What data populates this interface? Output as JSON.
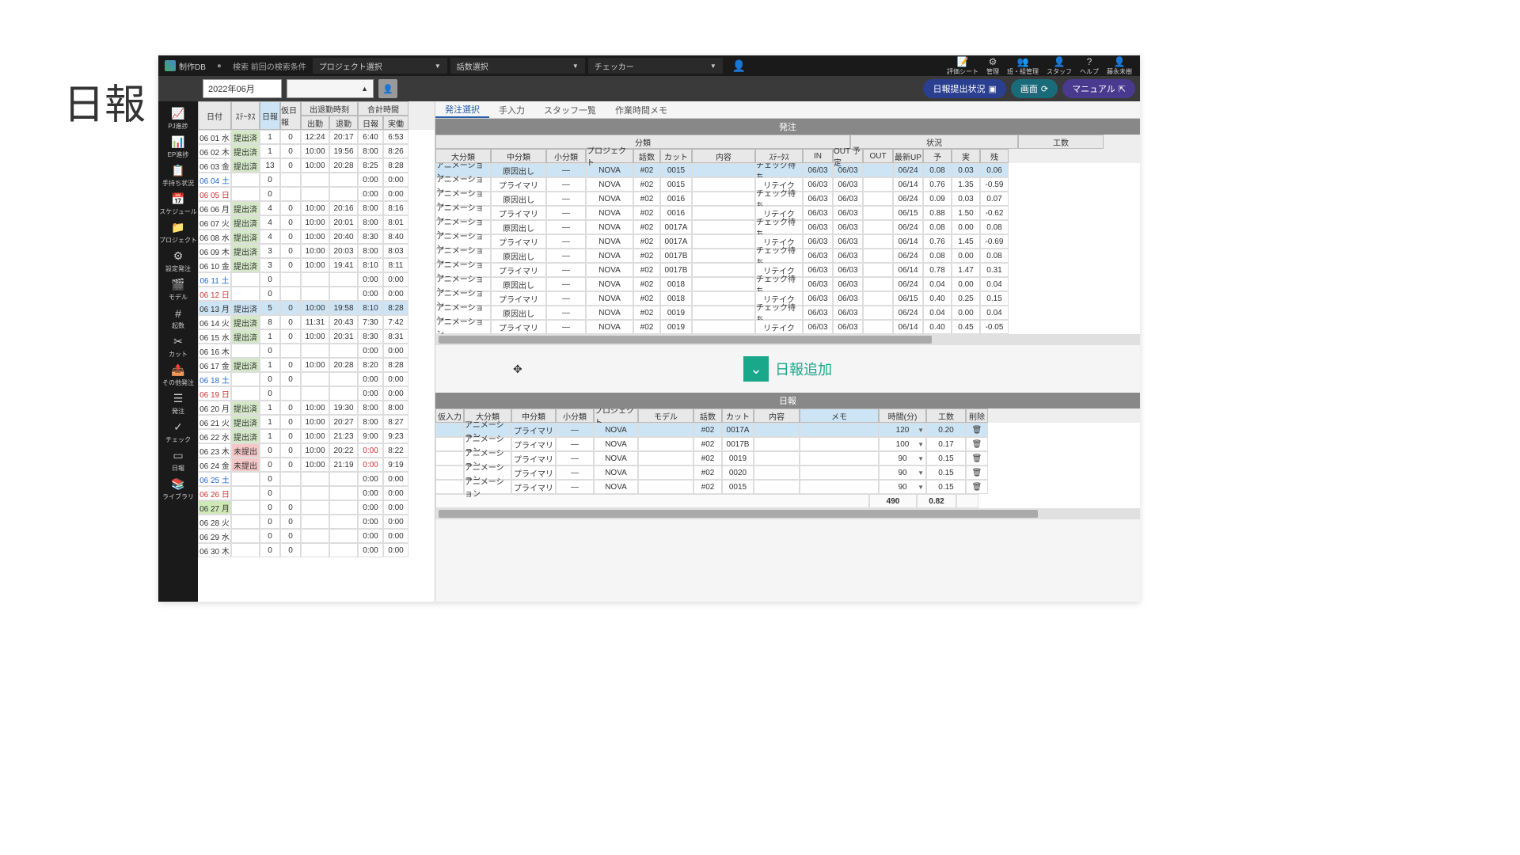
{
  "page_title": "日報",
  "topbar": {
    "app_name": "制作DB",
    "search_label": "検索 前回の検索条件",
    "dropdowns": [
      "プロジェクト選択",
      "話数選択",
      "チェッカー"
    ],
    "right_buttons": [
      {
        "icon": "📝",
        "label": "評価シート"
      },
      {
        "icon": "⚙",
        "label": "管理"
      },
      {
        "icon": "👥",
        "label": "班・組管理"
      },
      {
        "icon": "👤",
        "label": "スタッフ"
      },
      {
        "icon": "?",
        "label": "ヘルプ"
      },
      {
        "icon": "👤",
        "label": "藤永未樹"
      }
    ]
  },
  "filterbar": {
    "month": "2022年06月",
    "pills": [
      {
        "label": "日報提出状況",
        "icon": "▣"
      },
      {
        "label": "画面",
        "icon": "⟳"
      },
      {
        "label": "マニュアル",
        "icon": "⇱"
      }
    ]
  },
  "sidenav": [
    {
      "icon": "📈",
      "label": "PJ進捗"
    },
    {
      "icon": "📊",
      "label": "EP進捗"
    },
    {
      "icon": "📋",
      "label": "手持ち状況"
    },
    {
      "icon": "📅",
      "label": "スケジュール"
    },
    {
      "icon": "📁",
      "label": "プロジェクト"
    },
    {
      "icon": "⚙",
      "label": "設定発注"
    },
    {
      "icon": "🎬",
      "label": "モデル"
    },
    {
      "icon": "#",
      "label": "起数"
    },
    {
      "icon": "✂",
      "label": "カット"
    },
    {
      "icon": "📤",
      "label": "その他発注"
    },
    {
      "icon": "☰",
      "label": "発注"
    },
    {
      "icon": "✓",
      "label": "チェック"
    },
    {
      "icon": "▭",
      "label": "日報"
    },
    {
      "icon": "📚",
      "label": "ライブラリ"
    }
  ],
  "left_table": {
    "head_top": [
      "日付",
      "ｽﾃｰﾀｽ",
      "日報",
      "仮日報",
      "出退勤時刻",
      "合計時間"
    ],
    "head_bot": [
      "出勤",
      "退勤",
      "日報",
      "実働"
    ],
    "rows": [
      {
        "d": "06 01 水",
        "st": "提出済",
        "n": "1",
        "k": "0",
        "in": "12:24",
        "out": "20:17",
        "hn": "6:40",
        "jw": "6:53"
      },
      {
        "d": "06 02 木",
        "st": "提出済",
        "n": "1",
        "k": "0",
        "in": "10:00",
        "out": "19:56",
        "hn": "8:00",
        "jw": "8:26"
      },
      {
        "d": "06 03 金",
        "st": "提出済",
        "n": "13",
        "k": "0",
        "in": "10:00",
        "out": "20:28",
        "hn": "8:25",
        "jw": "8:28"
      },
      {
        "d": "06 04 土",
        "cls": "sat",
        "st": "",
        "n": "0",
        "k": "",
        "in": "",
        "out": "",
        "hn": "0:00",
        "jw": "0:00"
      },
      {
        "d": "06 05 日",
        "cls": "sun",
        "st": "",
        "n": "0",
        "k": "",
        "in": "",
        "out": "",
        "hn": "0:00",
        "jw": "0:00"
      },
      {
        "d": "06 06 月",
        "st": "提出済",
        "n": "4",
        "k": "0",
        "in": "10:00",
        "out": "20:16",
        "hn": "8:00",
        "jw": "8:16"
      },
      {
        "d": "06 07 火",
        "st": "提出済",
        "n": "4",
        "k": "0",
        "in": "10:00",
        "out": "20:01",
        "hn": "8:00",
        "jw": "8:01"
      },
      {
        "d": "06 08 水",
        "st": "提出済",
        "n": "4",
        "k": "0",
        "in": "10:00",
        "out": "20:40",
        "hn": "8:30",
        "jw": "8:40"
      },
      {
        "d": "06 09 木",
        "st": "提出済",
        "n": "3",
        "k": "0",
        "in": "10:00",
        "out": "20:03",
        "hn": "8:00",
        "jw": "8:03"
      },
      {
        "d": "06 10 金",
        "st": "提出済",
        "n": "3",
        "k": "0",
        "in": "10:00",
        "out": "19:41",
        "hn": "8:10",
        "jw": "8:11"
      },
      {
        "d": "06 11 土",
        "cls": "sat",
        "st": "",
        "n": "0",
        "k": "",
        "in": "",
        "out": "",
        "hn": "0:00",
        "jw": "0:00"
      },
      {
        "d": "06 12 日",
        "cls": "sun",
        "st": "",
        "n": "0",
        "k": "",
        "in": "",
        "out": "",
        "hn": "0:00",
        "jw": "0:00"
      },
      {
        "d": "06 13 月",
        "cls": "sel",
        "st": "提出済",
        "n": "5",
        "k": "0",
        "in": "10:00",
        "out": "19:58",
        "hn": "8:10",
        "jw": "8:28"
      },
      {
        "d": "06 14 火",
        "st": "提出済",
        "n": "8",
        "k": "0",
        "in": "11:31",
        "out": "20:43",
        "hn": "7:30",
        "jw": "7:42"
      },
      {
        "d": "06 15 水",
        "st": "提出済",
        "n": "1",
        "k": "0",
        "in": "10:00",
        "out": "20:31",
        "hn": "8:30",
        "jw": "8:31"
      },
      {
        "d": "06 16 木",
        "st": "",
        "n": "0",
        "k": "",
        "in": "",
        "out": "",
        "hn": "0:00",
        "jw": "0:00"
      },
      {
        "d": "06 17 金",
        "st": "提出済",
        "n": "1",
        "k": "0",
        "in": "10:00",
        "out": "20:28",
        "hn": "8:20",
        "jw": "8:28"
      },
      {
        "d": "06 18 土",
        "cls": "sat",
        "st": "",
        "n": "0",
        "k": "0",
        "in": "",
        "out": "",
        "hn": "0:00",
        "jw": "0:00"
      },
      {
        "d": "06 19 日",
        "cls": "sun",
        "st": "",
        "n": "0",
        "k": "",
        "in": "",
        "out": "",
        "hn": "0:00",
        "jw": "0:00"
      },
      {
        "d": "06 20 月",
        "st": "提出済",
        "n": "1",
        "k": "0",
        "in": "10:00",
        "out": "19:30",
        "hn": "8:00",
        "jw": "8:00"
      },
      {
        "d": "06 21 火",
        "st": "提出済",
        "n": "1",
        "k": "0",
        "in": "10:00",
        "out": "20:27",
        "hn": "8:00",
        "jw": "8:27"
      },
      {
        "d": "06 22 水",
        "st": "提出済",
        "n": "1",
        "k": "0",
        "in": "10:00",
        "out": "21:23",
        "hn": "9:00",
        "jw": "9:23"
      },
      {
        "d": "06 23 木",
        "st": "未提出",
        "stc": "pend",
        "n": "0",
        "k": "0",
        "in": "10:00",
        "out": "20:22",
        "hn": "0:00",
        "hnc": "red",
        "jw": "8:22"
      },
      {
        "d": "06 24 金",
        "st": "未提出",
        "stc": "pend",
        "n": "0",
        "k": "0",
        "in": "10:00",
        "out": "21:19",
        "hn": "0:00",
        "hnc": "red",
        "jw": "9:19"
      },
      {
        "d": "06 25 土",
        "cls": "sat",
        "st": "",
        "n": "0",
        "k": "",
        "in": "",
        "out": "",
        "hn": "0:00",
        "jw": "0:00"
      },
      {
        "d": "06 26 日",
        "cls": "sun",
        "st": "",
        "n": "0",
        "k": "",
        "in": "",
        "out": "",
        "hn": "0:00",
        "jw": "0:00"
      },
      {
        "d": "06 27 月",
        "cls": "today",
        "st": "",
        "n": "0",
        "k": "0",
        "in": "",
        "out": "",
        "hn": "0:00",
        "jw": "0:00"
      },
      {
        "d": "06 28 火",
        "st": "",
        "n": "0",
        "k": "0",
        "in": "",
        "out": "",
        "hn": "0:00",
        "jw": "0:00"
      },
      {
        "d": "06 29 水",
        "st": "",
        "n": "0",
        "k": "0",
        "in": "",
        "out": "",
        "hn": "0:00",
        "jw": "0:00"
      },
      {
        "d": "06 30 木",
        "st": "",
        "n": "0",
        "k": "0",
        "in": "",
        "out": "",
        "hn": "0:00",
        "jw": "0:00"
      }
    ]
  },
  "tabs": [
    "発注選択",
    "手入力",
    "スタッフ一覧",
    "作業時間メモ"
  ],
  "order": {
    "title": "発注",
    "group_heads": [
      "分類",
      "状況",
      "工数"
    ],
    "cols": [
      "大分類",
      "中分類",
      "小分類",
      "プロジェクト",
      "話数",
      "カット",
      "内容",
      "ｽﾃｰﾀｽ",
      "IN",
      "OUT 予定",
      "OUT",
      "最新UP",
      "予",
      "実",
      "残"
    ],
    "rows": [
      {
        "sel": true,
        "l": "アニメーション",
        "m": "原因出し",
        "s": "—",
        "p": "NOVA",
        "e": "#02",
        "cut": "0015",
        "nai": "",
        "st": "チェック待ち",
        "in": "06/03",
        "outp": "06/03",
        "out": "",
        "up": "06/24",
        "yo": "0.08",
        "ji": "0.03",
        "za": "0.06"
      },
      {
        "l": "アニメーション",
        "m": "プライマリ",
        "s": "—",
        "p": "NOVA",
        "e": "#02",
        "cut": "0015",
        "nai": "",
        "st": "リテイク",
        "in": "06/03",
        "outp": "06/03",
        "out": "",
        "up": "06/14",
        "yo": "0.76",
        "ji": "1.35",
        "za": "-0.59"
      },
      {
        "l": "アニメーション",
        "m": "原因出し",
        "s": "—",
        "p": "NOVA",
        "e": "#02",
        "cut": "0016",
        "nai": "",
        "st": "チェック待ち",
        "in": "06/03",
        "outp": "06/03",
        "out": "",
        "up": "06/24",
        "yo": "0.09",
        "ji": "0.03",
        "za": "0.07"
      },
      {
        "l": "アニメーション",
        "m": "プライマリ",
        "s": "—",
        "p": "NOVA",
        "e": "#02",
        "cut": "0016",
        "nai": "",
        "st": "リテイク",
        "in": "06/03",
        "outp": "06/03",
        "out": "",
        "up": "06/15",
        "yo": "0.88",
        "ji": "1.50",
        "za": "-0.62"
      },
      {
        "l": "アニメーション",
        "m": "原因出し",
        "s": "—",
        "p": "NOVA",
        "e": "#02",
        "cut": "0017A",
        "nai": "",
        "st": "チェック待ち",
        "in": "06/03",
        "outp": "06/03",
        "out": "",
        "up": "06/24",
        "yo": "0.08",
        "ji": "0.00",
        "za": "0.08"
      },
      {
        "l": "アニメーション",
        "m": "プライマリ",
        "s": "—",
        "p": "NOVA",
        "e": "#02",
        "cut": "0017A",
        "nai": "",
        "st": "リテイク",
        "in": "06/03",
        "outp": "06/03",
        "out": "",
        "up": "06/14",
        "yo": "0.76",
        "ji": "1.45",
        "za": "-0.69"
      },
      {
        "l": "アニメーション",
        "m": "原因出し",
        "s": "—",
        "p": "NOVA",
        "e": "#02",
        "cut": "0017B",
        "nai": "",
        "st": "チェック待ち",
        "in": "06/03",
        "outp": "06/03",
        "out": "",
        "up": "06/24",
        "yo": "0.08",
        "ji": "0.00",
        "za": "0.08"
      },
      {
        "l": "アニメーション",
        "m": "プライマリ",
        "s": "—",
        "p": "NOVA",
        "e": "#02",
        "cut": "0017B",
        "nai": "",
        "st": "リテイク",
        "in": "06/03",
        "outp": "06/03",
        "out": "",
        "up": "06/14",
        "yo": "0.78",
        "ji": "1.47",
        "za": "0.31"
      },
      {
        "l": "アニメーション",
        "m": "原因出し",
        "s": "—",
        "p": "NOVA",
        "e": "#02",
        "cut": "0018",
        "nai": "",
        "st": "チェック待ち",
        "in": "06/03",
        "outp": "06/03",
        "out": "",
        "up": "06/24",
        "yo": "0.04",
        "ji": "0.00",
        "za": "0.04"
      },
      {
        "l": "アニメーション",
        "m": "プライマリ",
        "s": "—",
        "p": "NOVA",
        "e": "#02",
        "cut": "0018",
        "nai": "",
        "st": "リテイク",
        "in": "06/03",
        "outp": "06/03",
        "out": "",
        "up": "06/15",
        "yo": "0.40",
        "ji": "0.25",
        "za": "0.15"
      },
      {
        "l": "アニメーション",
        "m": "原因出し",
        "s": "—",
        "p": "NOVA",
        "e": "#02",
        "cut": "0019",
        "nai": "",
        "st": "チェック待ち",
        "in": "06/03",
        "outp": "06/03",
        "out": "",
        "up": "06/24",
        "yo": "0.04",
        "ji": "0.00",
        "za": "0.04"
      },
      {
        "l": "アニメーション",
        "m": "プライマリ",
        "s": "—",
        "p": "NOVA",
        "e": "#02",
        "cut": "0019",
        "nai": "",
        "st": "リテイク",
        "in": "06/03",
        "outp": "06/03",
        "out": "",
        "up": "06/14",
        "yo": "0.40",
        "ji": "0.45",
        "za": "-0.05"
      }
    ]
  },
  "addbtn": "日報追加",
  "nippo": {
    "title": "日報",
    "cols": [
      "仮入力",
      "大分類",
      "中分類",
      "小分類",
      "プロジェクト",
      "モデル",
      "話数",
      "カット",
      "内容",
      "メモ",
      "時間(分)",
      "工数",
      "削除"
    ],
    "rows": [
      {
        "sel": true,
        "l": "アニメーション",
        "m": "プライマリ",
        "s": "—",
        "p": "NOVA",
        "mo": "",
        "e": "#02",
        "cut": "0017A",
        "nai": "",
        "memo": "",
        "t": "120",
        "ko": "0.20"
      },
      {
        "l": "アニメーション",
        "m": "プライマリ",
        "s": "—",
        "p": "NOVA",
        "mo": "",
        "e": "#02",
        "cut": "0017B",
        "nai": "",
        "memo": "",
        "t": "100",
        "ko": "0.17"
      },
      {
        "l": "アニメーション",
        "m": "プライマリ",
        "s": "—",
        "p": "NOVA",
        "mo": "",
        "e": "#02",
        "cut": "0019",
        "nai": "",
        "memo": "",
        "t": "90",
        "ko": "0.15"
      },
      {
        "l": "アニメーション",
        "m": "プライマリ",
        "s": "—",
        "p": "NOVA",
        "mo": "",
        "e": "#02",
        "cut": "0020",
        "nai": "",
        "memo": "",
        "t": "90",
        "ko": "0.15"
      },
      {
        "l": "アニメーション",
        "m": "プライマリ",
        "s": "—",
        "p": "NOVA",
        "mo": "",
        "e": "#02",
        "cut": "0015",
        "nai": "",
        "memo": "",
        "t": "90",
        "ko": "0.15"
      }
    ],
    "total_t": "490",
    "total_ko": "0.82"
  }
}
